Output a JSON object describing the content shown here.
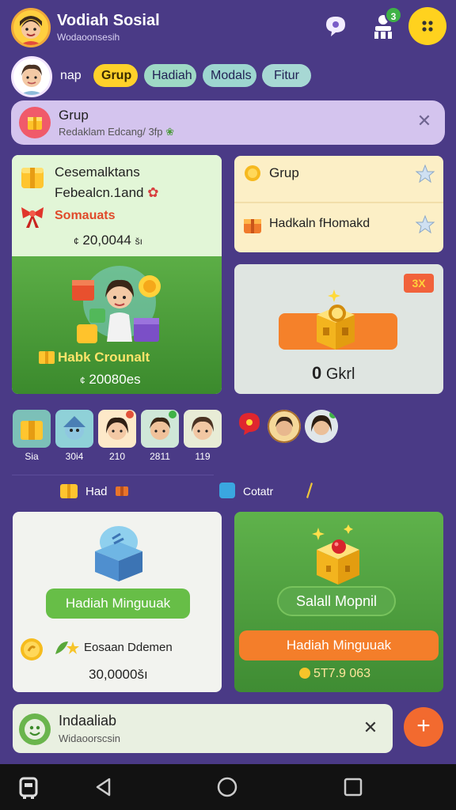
{
  "header": {
    "title": "Vodiah Sosial",
    "subtitle": "Wodaoonsesih",
    "badge_count": "3"
  },
  "tabs": {
    "plain": "nap",
    "items": [
      "Grup",
      "Hadiah",
      "Modals",
      "Fitur"
    ]
  },
  "notification": {
    "title": "Grup",
    "subtitle": "Redaklam Edcang/ 3fp"
  },
  "card_left": {
    "title1": "Cesemalktans",
    "title2": "Febealcn.1and",
    "subtitle": "Somauats",
    "amount": "20,0044",
    "amount_prefix": "¢",
    "amount_suffix": "šı",
    "label": "Habk Crounalt",
    "amount2": "20080es",
    "amount2_prefix": "¢"
  },
  "card_rt": {
    "row1": "Grup",
    "row2": "Hadkaln fHomakd"
  },
  "card_rm": {
    "tag": "3X",
    "count_num": "0",
    "count_label": "Gkrl"
  },
  "avatars": [
    {
      "label": "Sia"
    },
    {
      "label": "30i4"
    },
    {
      "label": "210"
    },
    {
      "label": "2811"
    },
    {
      "label": "119"
    }
  ],
  "section_left": {
    "label": "Had"
  },
  "section_right": {
    "label": "Cotatr"
  },
  "card_bl": {
    "button": "Hadiah Minguuak",
    "label": "Eosaan Ddemen",
    "amount": "30,0000šı"
  },
  "card_br": {
    "pill": "Salall Mopnil",
    "button": "Hadiah Minguuak",
    "amount": "5T7.9 063"
  },
  "bottom_notification": {
    "title": "Indaaliab",
    "subtitle": "Widaoorscsin"
  },
  "colors": {
    "background": "#4a3a86",
    "accent_yellow": "#ffd21e",
    "accent_green": "#5fb24b",
    "accent_orange": "#f47e2a"
  }
}
